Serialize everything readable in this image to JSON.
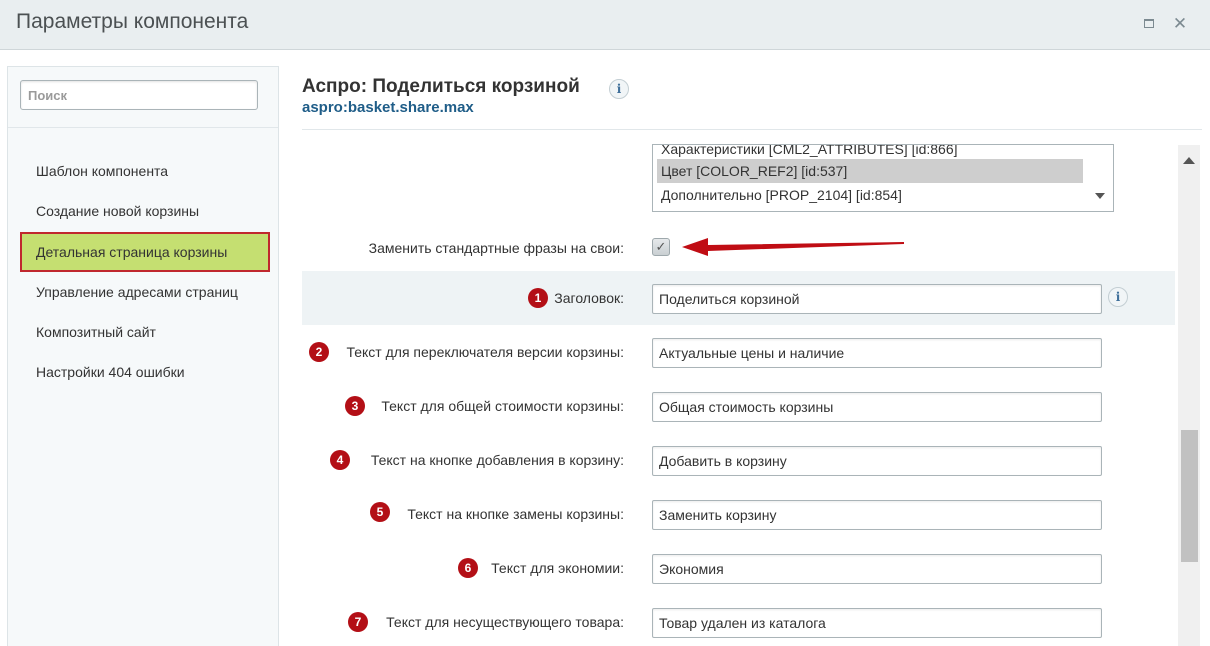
{
  "window": {
    "title": "Параметры компонента",
    "maximize_icon": "maximize-icon",
    "close_icon": "close-icon",
    "close_glyph": "✕"
  },
  "sidebar": {
    "search_placeholder": "Поиск",
    "items": [
      {
        "label": "Шаблон компонента",
        "active": false
      },
      {
        "label": "Создание новой корзины",
        "active": false
      },
      {
        "label": "Детальная страница корзины",
        "active": true
      },
      {
        "label": "Управление адресами страниц",
        "active": false
      },
      {
        "label": "Композитный сайт",
        "active": false
      },
      {
        "label": "Настройки 404 ошибки",
        "active": false
      }
    ]
  },
  "component": {
    "title": "Аспро: Поделиться корзиной",
    "code": "aspro:basket.share.max",
    "info_glyph": "i"
  },
  "listbox": {
    "options": [
      {
        "label": "Характеристики [CML2_ATTRIBUTES] [id:866]",
        "selected": false
      },
      {
        "label": "Цвет [COLOR_REF2] [id:537]",
        "selected": true
      },
      {
        "label": "Дополнительно [PROP_2104] [id:854]",
        "selected": false
      }
    ]
  },
  "replace_phrases": {
    "label": "Заменить стандартные фразы на свои:",
    "checked": true,
    "check_glyph": "✓"
  },
  "fields": [
    {
      "num": "1",
      "label": "Заголовок:",
      "value": "Поделиться корзиной"
    },
    {
      "num": "2",
      "label": "Текст для переключателя версии корзины:",
      "value": "Актуальные цены и наличие"
    },
    {
      "num": "3",
      "label": "Текст для общей стоимости корзины:",
      "value": "Общая стоимость корзины"
    },
    {
      "num": "4",
      "label": "Текст на кнопке добавления в корзину:",
      "value": "Добавить в корзину"
    },
    {
      "num": "5",
      "label": "Текст на кнопке замены корзины:",
      "value": "Заменить корзину"
    },
    {
      "num": "6",
      "label": "Текст для экономии:",
      "value": "Экономия"
    },
    {
      "num": "7",
      "label": "Текст для несуществующего товара:",
      "value": "Товар удален из каталога"
    }
  ],
  "colors": {
    "accent_active": "#c5df71",
    "active_border": "#c0282e",
    "badge": "#b30f16",
    "arrow": "#c00d14",
    "link": "#1f5d88"
  }
}
